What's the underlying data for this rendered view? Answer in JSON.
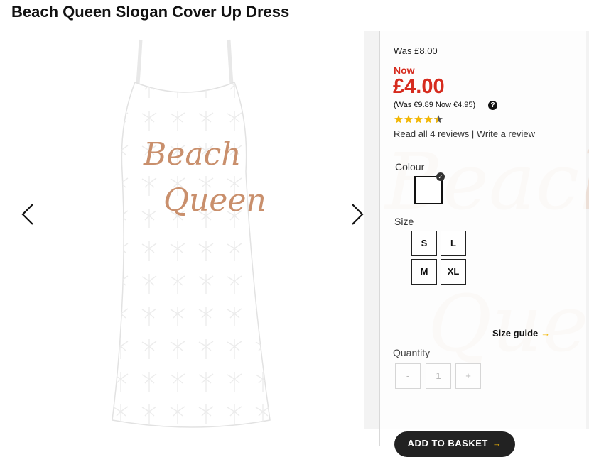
{
  "product": {
    "title": "Beach Queen Slogan Cover Up Dress",
    "print_line1": "Beach",
    "print_line2": "Queen"
  },
  "pricing": {
    "was": "Was £8.00",
    "now_label": "Now",
    "price": "£4.00",
    "euro": "(Was €9.89 Now €4.95)",
    "help_icon": "?"
  },
  "rating": {
    "stars": 4.5,
    "max": 5,
    "read_reviews": "Read all 4 reviews",
    "separator": "|",
    "write_review": "Write a review"
  },
  "colour": {
    "label": "Colour",
    "selected_swatch_color": "#ffffff",
    "check": "✓"
  },
  "size": {
    "label": "Size",
    "options": [
      "S",
      "L",
      "M",
      "XL"
    ],
    "guide": "Size guide",
    "guide_arrow": "→"
  },
  "quantity": {
    "label": "Quantity",
    "minus": "-",
    "value": "1",
    "plus": "+"
  },
  "cta": {
    "add_to_basket": "ADD TO BASKET",
    "arrow": "→"
  },
  "colors": {
    "price_red": "#d62b1e",
    "accent_yellow": "#f2b705",
    "print_rose_gold": "#c98f6c"
  },
  "icons": {
    "prev": "chevron-left-icon",
    "next": "chevron-right-icon",
    "help": "question-icon",
    "star": "star-icon"
  }
}
